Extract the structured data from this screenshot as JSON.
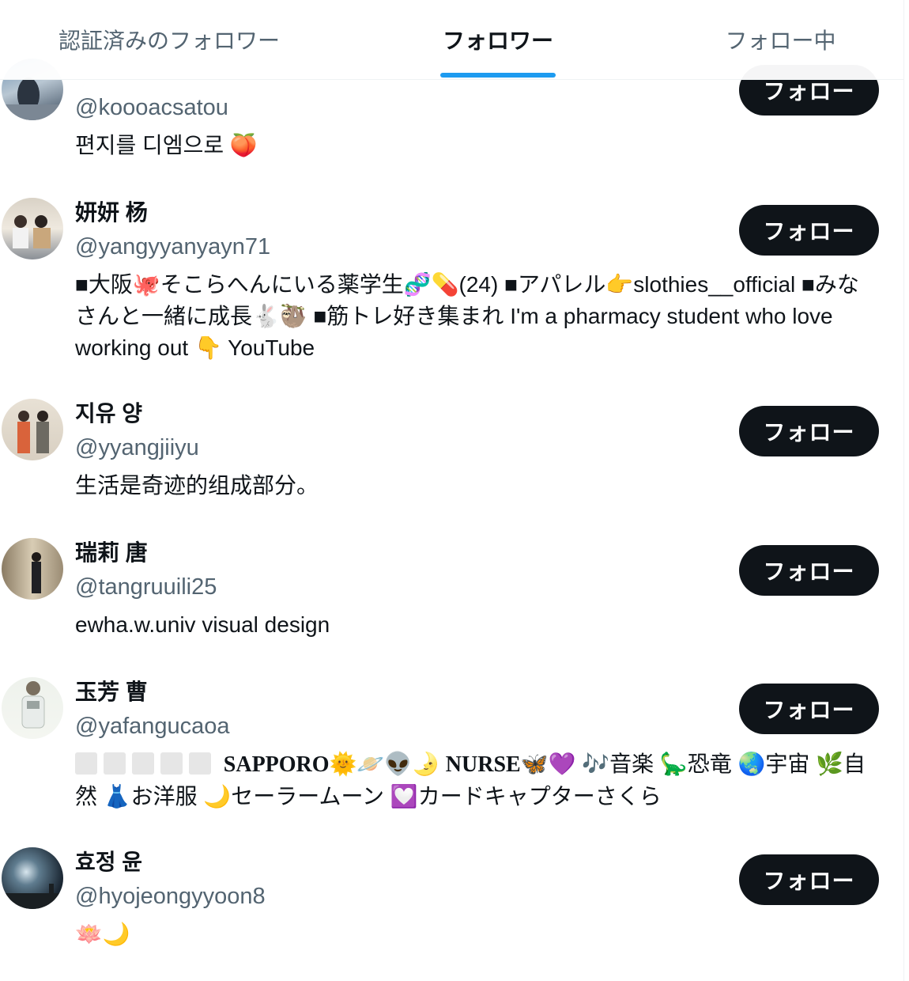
{
  "tabs": [
    {
      "label": "認証済みのフォロワー"
    },
    {
      "label": "フォロワー"
    },
    {
      "label": "フォロー中"
    }
  ],
  "accent_color": "#1d9bf0",
  "follow_label": "フォロー",
  "users": [
    {
      "name": "",
      "handle": "@koooacsatou",
      "bio": "편지를 디엠으로 🍑"
    },
    {
      "name": "妍妍 杨",
      "handle": "@yangyyanyayn71",
      "bio": "■大阪🐙そこらへんにいる薬学生🧬💊(24) ■アパレル👉slothies__official ■みなさんと一緒に成長🐇🦥 ■筋トレ好き集まれ I'm a pharmacy student who love working out 👇 YouTube"
    },
    {
      "name": "지유 양",
      "handle": "@yyangjiiyu",
      "bio": "生活是奇迹的组成部分。"
    },
    {
      "name": "瑞莉 唐",
      "handle": "@tangruuili25",
      "bio": "ewha.w.univ visual design"
    },
    {
      "name": "玉芳 曹",
      "handle": "@yafangucaoa",
      "bio_part1": "SAPPORO🌞🪐👽🌛",
      "bio_part2": "NURSE🦋💜",
      "bio_part3": " 🎶音楽 🦕恐竜 🌏宇宙 🌿自然 👗お洋服 🌙セーラームーン 💟カードキャプターさくら"
    },
    {
      "name": "효정 윤",
      "handle": "@hyojeongyyoon8",
      "bio": "🪷🌙"
    }
  ]
}
